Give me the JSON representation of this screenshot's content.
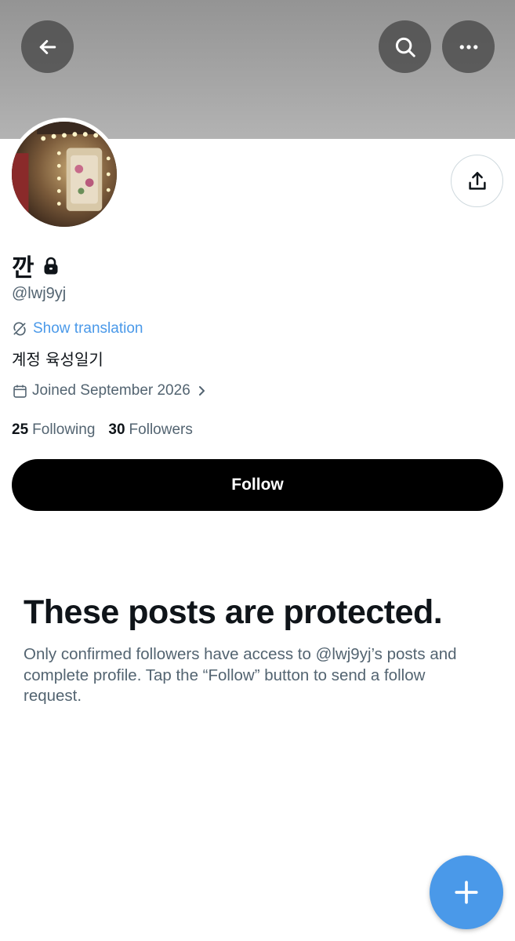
{
  "header": {
    "back_icon": "arrow-left-icon",
    "search_icon": "search-icon",
    "more_icon": "more-horizontal-icon",
    "banner_color": "#a0a0a0"
  },
  "profile": {
    "display_name": "깐",
    "locked": true,
    "handle": "@lwj9yj",
    "show_translation": "Show translation",
    "bio": "계정 육성일기",
    "joined": "Joined September 2026",
    "following_count": "25",
    "following_label": "Following",
    "followers_count": "30",
    "followers_label": "Followers",
    "follow_button": "Follow"
  },
  "protected": {
    "title": "These posts are protected.",
    "message": "Only confirmed followers have access to @lwj9yj’s posts and complete profile. Tap the “Follow” button to send a follow request."
  },
  "colors": {
    "accent": "#4a99e9",
    "text_primary": "#0f1419",
    "text_secondary": "#536471",
    "follow_button_bg": "#000000"
  },
  "fab_icon": "plus-icon"
}
